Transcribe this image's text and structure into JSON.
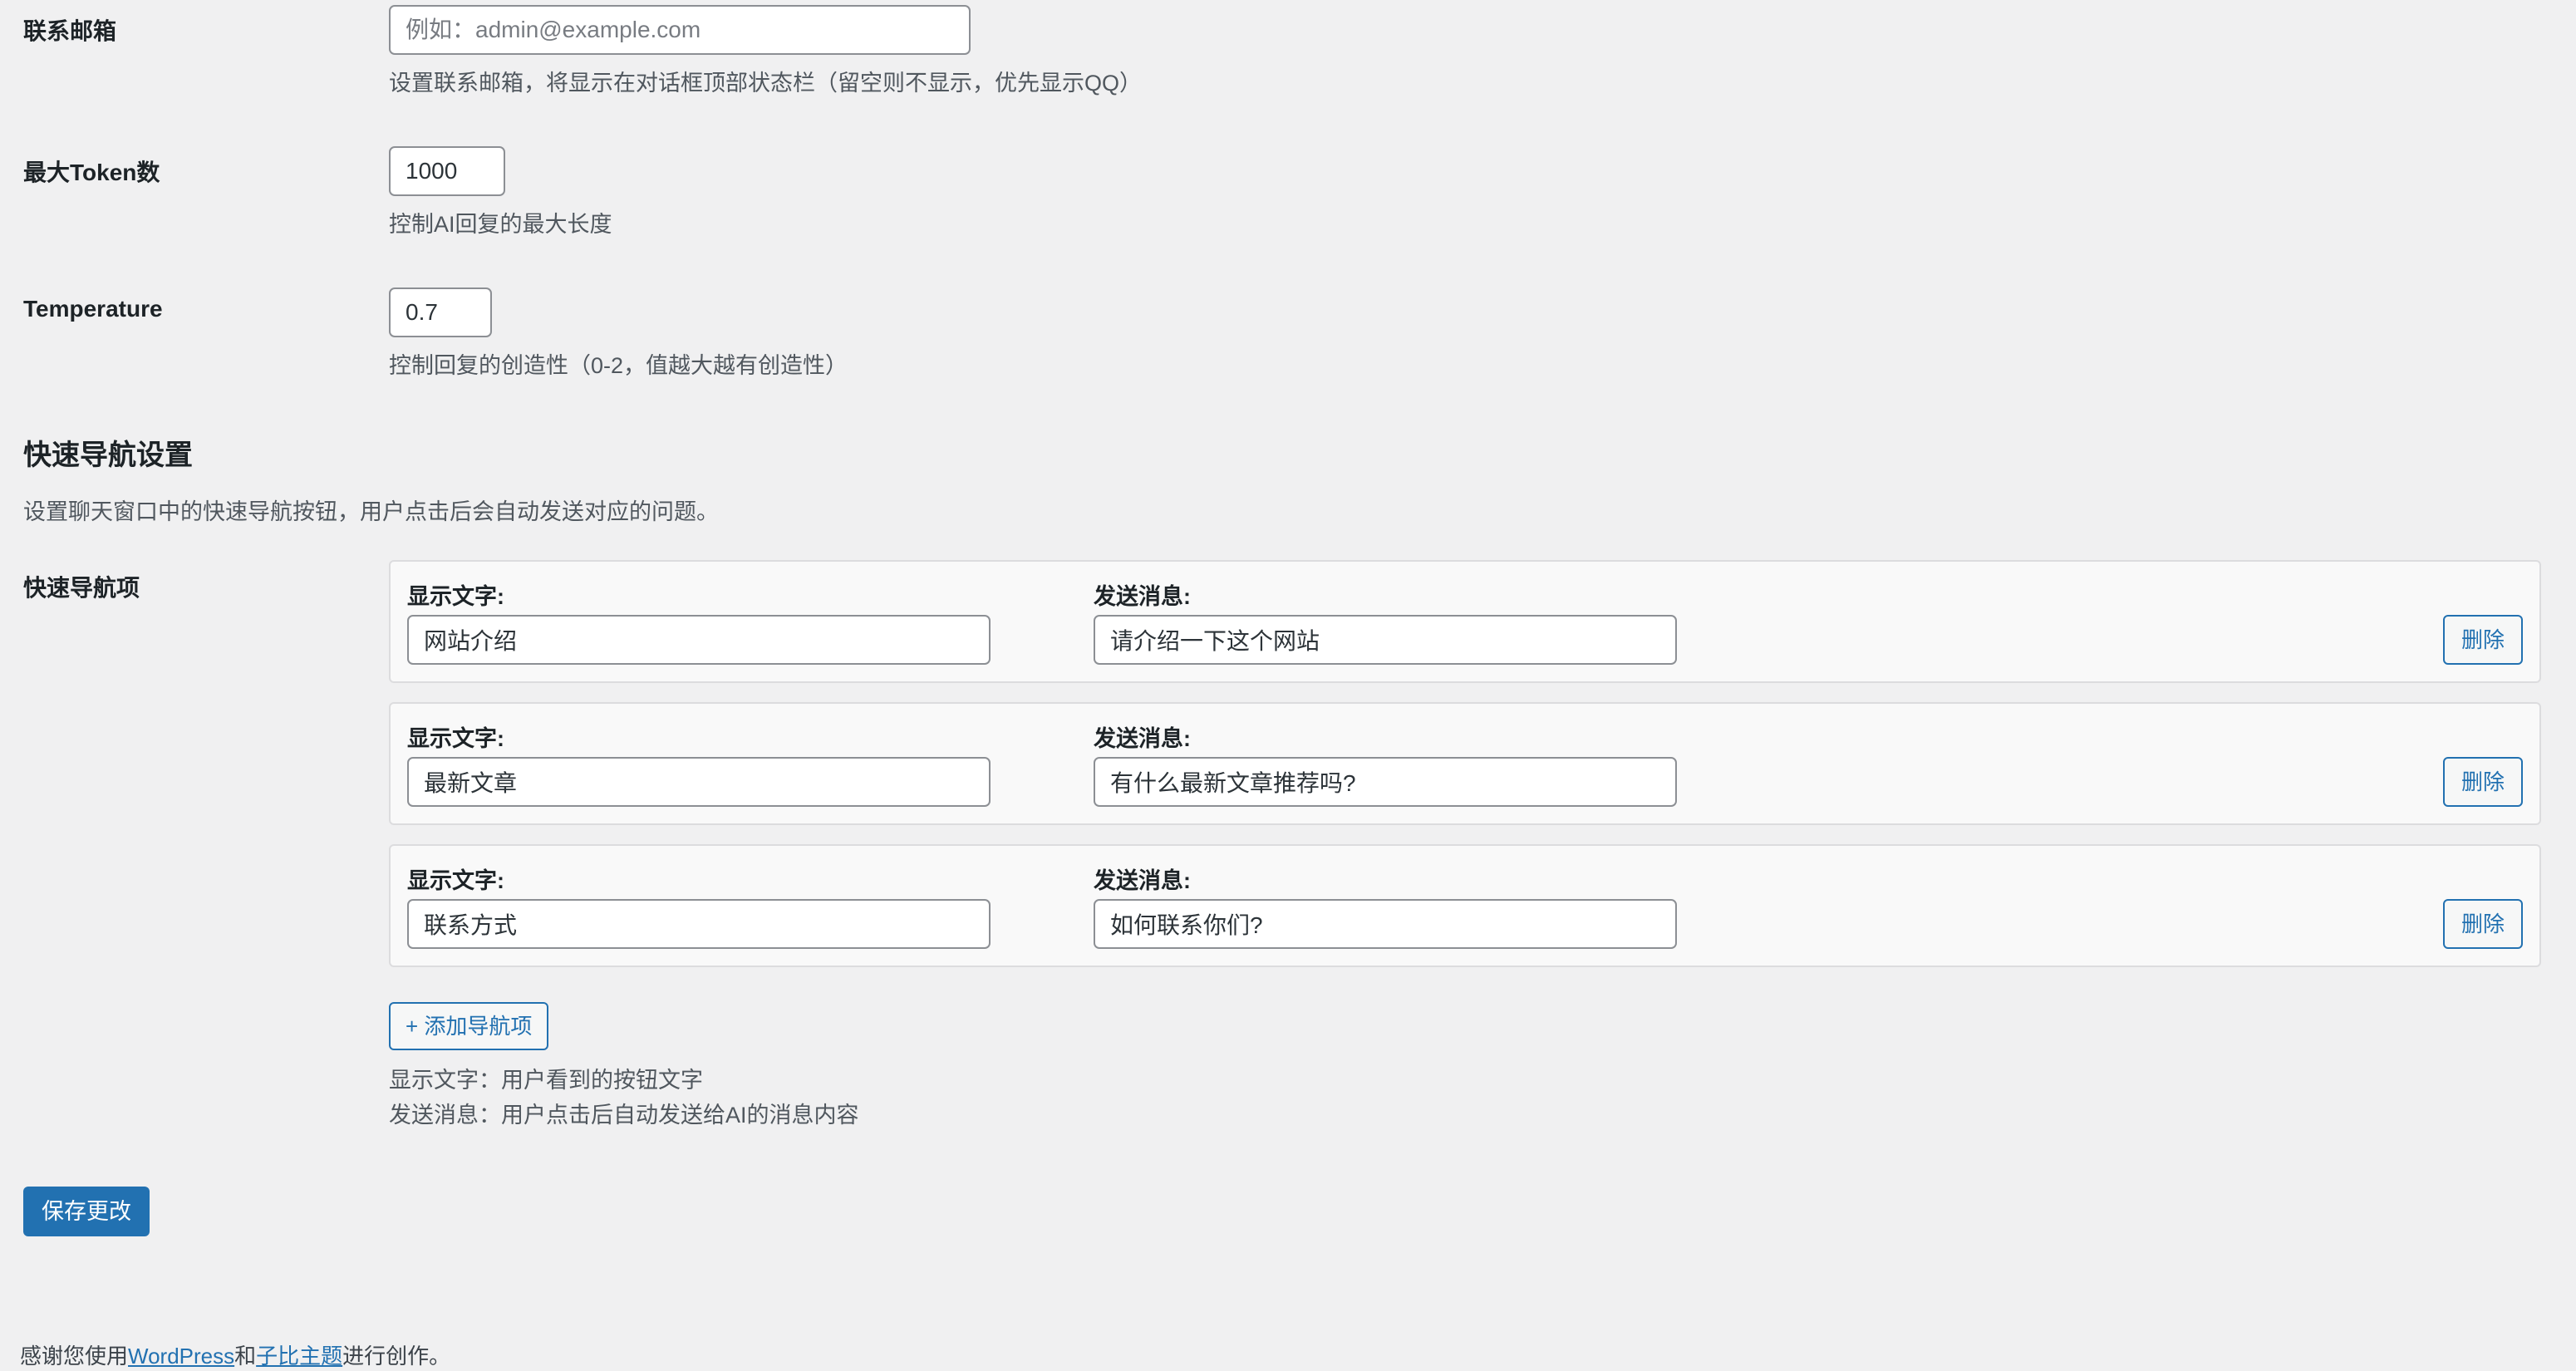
{
  "contact_email": {
    "label": "联系邮箱",
    "placeholder": "例如：admin@example.com",
    "value": "",
    "description": "设置联系邮箱，将显示在对话框顶部状态栏（留空则不显示，优先显示QQ）"
  },
  "max_tokens": {
    "label": "最大Token数",
    "value": "1000",
    "description": "控制AI回复的最大长度"
  },
  "temperature": {
    "label": "Temperature",
    "value": "0.7",
    "description": "控制回复的创造性（0-2，值越大越有创造性）"
  },
  "quick_nav": {
    "title": "快速导航设置",
    "description": "设置聊天窗口中的快速导航按钮，用户点击后会自动发送对应的问题。",
    "items_label": "快速导航项",
    "display_label": "显示文字:",
    "message_label": "发送消息:",
    "delete_label": "删除",
    "items": [
      {
        "display": "网站介绍",
        "message": "请介绍一下这个网站"
      },
      {
        "display": "最新文章",
        "message": "有什么最新文章推荐吗?"
      },
      {
        "display": "联系方式",
        "message": "如何联系你们?"
      }
    ],
    "add_label": "+ 添加导航项",
    "help_display": "显示文字：用户看到的按钮文字",
    "help_message": "发送消息：用户点击后自动发送给AI的消息内容"
  },
  "save_label": "保存更改",
  "footer": {
    "prefix": "感谢您使用",
    "link1": "WordPress",
    "middle": "和",
    "link2": "子比主题",
    "suffix": "进行创作。"
  }
}
